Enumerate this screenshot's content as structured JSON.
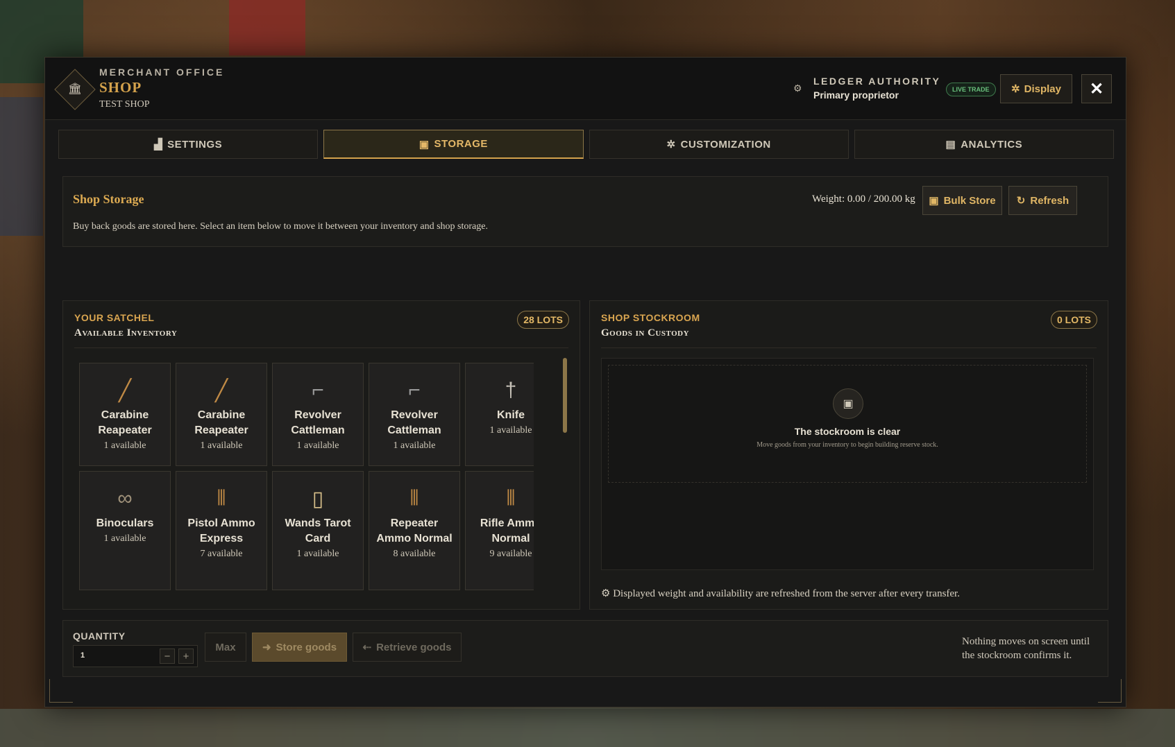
{
  "header": {
    "kicker": "MERCHANT OFFICE",
    "title": "SHOP",
    "subtitle": "TEST SHOP",
    "emblem_icon": "shop-icon",
    "ledger_label": "LEDGER AUTHORITY",
    "ledger_value": "Primary proprietor",
    "badge": "LIVE TRADE",
    "display_label": "Display",
    "close_label": "✕"
  },
  "tabs": [
    {
      "label": "SETTINGS",
      "icon": "chart-icon"
    },
    {
      "label": "STORAGE",
      "icon": "box-icon"
    },
    {
      "label": "CUSTOMIZATION",
      "icon": "gear-icon"
    },
    {
      "label": "ANALYTICS",
      "icon": "clipboard-icon"
    }
  ],
  "storage": {
    "title": "Shop Storage",
    "description": "Buy back goods are stored here. Select an item below to move it between your inventory and shop storage.",
    "weight": "Weight: 0.00 / 200.00 kg",
    "bulk_store_label": "Bulk Store",
    "refresh_label": "Refresh"
  },
  "satchel": {
    "kicker": "YOUR SATCHEL",
    "title": "Available Inventory",
    "lots": "28 LOTS",
    "items": [
      {
        "name": "Carabine Reapeater",
        "avail": "1 available",
        "icon": "rifle-icon"
      },
      {
        "name": "Carabine Reapeater",
        "avail": "1 available",
        "icon": "rifle-icon"
      },
      {
        "name": "Revolver Cattleman",
        "avail": "1 available",
        "icon": "revolver-icon"
      },
      {
        "name": "Revolver Cattleman",
        "avail": "1 available",
        "icon": "revolver-icon"
      },
      {
        "name": "Knife",
        "avail": "1 available",
        "icon": "knife-icon"
      },
      {
        "name": "Binoculars",
        "avail": "1 available",
        "icon": "binoculars-icon"
      },
      {
        "name": "Pistol Ammo Express",
        "avail": "7 available",
        "icon": "ammo-icon"
      },
      {
        "name": "Wands Tarot Card",
        "avail": "1 available",
        "icon": "tarot-card-icon"
      },
      {
        "name": "Repeater Ammo Normal",
        "avail": "8 available",
        "icon": "ammo-icon"
      },
      {
        "name": "Rifle Ammo Normal",
        "avail": "9 available",
        "icon": "ammo-icon"
      }
    ]
  },
  "stockroom": {
    "kicker": "SHOP STOCKROOM",
    "title": "Goods in Custody",
    "lots": "0 LOTS",
    "empty_title": "The stockroom is clear",
    "empty_sub": "Move goods from your inventory to begin building reserve stock.",
    "note": "Displayed weight and availability are refreshed from the server after every transfer."
  },
  "quantity": {
    "label": "QUANTITY",
    "value": "1",
    "max_label": "Max",
    "store_label": "Store goods",
    "retrieve_label": "Retrieve goods",
    "note": "Nothing moves on screen until the stockroom confirms it."
  }
}
